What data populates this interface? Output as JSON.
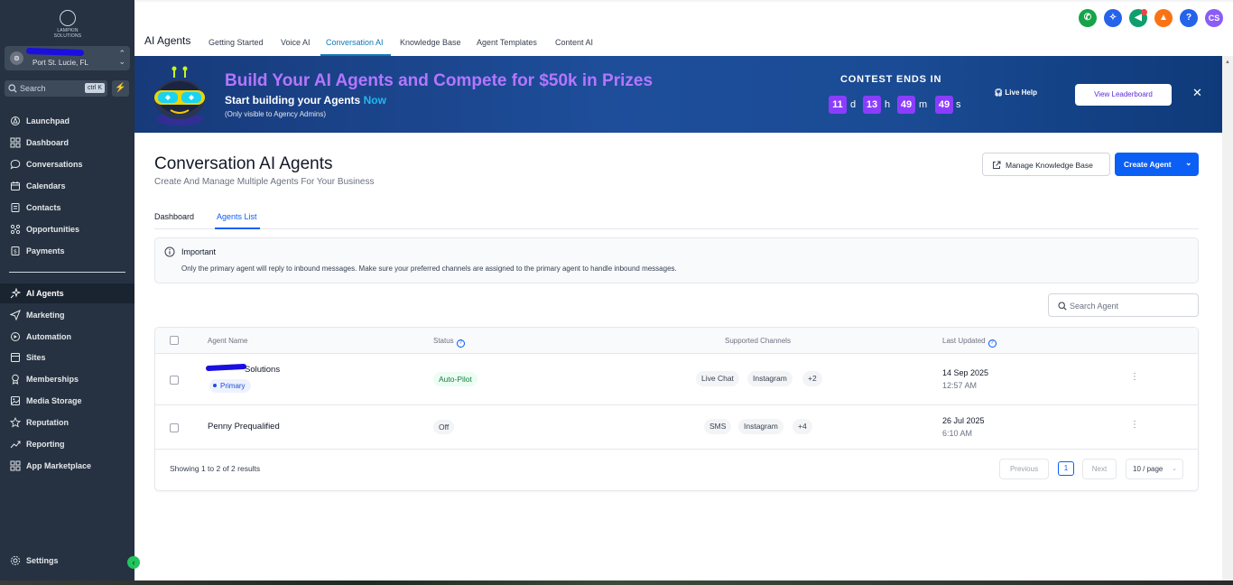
{
  "sidebar": {
    "logo_text": "LAMPKIN SOLUTIONS",
    "location": {
      "avatar": "⊚",
      "city": "Port St. Lucie, FL"
    },
    "search": {
      "placeholder": "Search",
      "shortcut": "ctrl K"
    },
    "nav_top": [
      {
        "label": "Launchpad",
        "icon": "rocket-icon"
      },
      {
        "label": "Dashboard",
        "icon": "grid-icon"
      },
      {
        "label": "Conversations",
        "icon": "chat-icon"
      },
      {
        "label": "Calendars",
        "icon": "calendar-icon"
      },
      {
        "label": "Contacts",
        "icon": "contacts-icon"
      },
      {
        "label": "Opportunities",
        "icon": "opportunities-icon"
      },
      {
        "label": "Payments",
        "icon": "payments-icon"
      }
    ],
    "nav_bottom": [
      {
        "label": "AI Agents",
        "icon": "sparkle-icon",
        "active": true
      },
      {
        "label": "Marketing",
        "icon": "send-icon"
      },
      {
        "label": "Automation",
        "icon": "automation-icon"
      },
      {
        "label": "Sites",
        "icon": "globe-icon"
      },
      {
        "label": "Memberships",
        "icon": "memberships-icon"
      },
      {
        "label": "Media Storage",
        "icon": "image-icon"
      },
      {
        "label": "Reputation",
        "icon": "star-icon"
      },
      {
        "label": "Reporting",
        "icon": "trend-icon"
      },
      {
        "label": "App Marketplace",
        "icon": "apps-icon"
      }
    ],
    "settings_label": "Settings"
  },
  "header": {
    "section_title": "AI Agents",
    "tabs": [
      "Getting Started",
      "Voice AI",
      "Conversation AI",
      "Knowledge Base",
      "Agent Templates",
      "Content AI"
    ],
    "active_tab": "Conversation AI",
    "user_initials": "CS",
    "help_label": "?"
  },
  "banner": {
    "title": "Build Your AI Agents and Compete for $50k in Prizes",
    "subtitle": "Start building your Agents",
    "subtitle_em": "Now",
    "note": "(Only visible to Agency Admins)",
    "contest_label": "CONTEST ENDS IN",
    "countdown": {
      "days": "11",
      "hours": "13",
      "minutes": "49",
      "seconds": "49"
    },
    "units": {
      "d": "d",
      "h": "h",
      "m": "m",
      "s": "s"
    },
    "live_help": "Live Help",
    "leaderboard_button": "View Leaderboard",
    "close": "✕"
  },
  "page": {
    "title": "Conversation AI Agents",
    "subtitle": "Create And Manage Multiple Agents For Your Business",
    "manage_kb_button": "Manage Knowledge Base",
    "create_button": "Create Agent",
    "subtabs": [
      "Dashboard",
      "Agents List"
    ],
    "active_subtab": "Agents List",
    "notice": {
      "title": "Important",
      "text": "Only the primary agent will reply to inbound messages. Make sure your preferred channels are assigned to the primary agent to handle inbound messages."
    },
    "search_placeholder": "Search Agent"
  },
  "table": {
    "columns": [
      "Agent Name",
      "Status",
      "Supported Channels",
      "Last Updated"
    ],
    "rows": [
      {
        "name": "Solutions",
        "badge": "Primary",
        "status": "Auto-Pilot",
        "channels": [
          "Live Chat",
          "Instagram",
          "+2"
        ],
        "date": "14 Sep 2025",
        "time": "12:57 AM"
      },
      {
        "name": "Penny Prequalified",
        "badge": "",
        "status": "Off",
        "channels": [
          "SMS",
          "Instagram",
          "+4"
        ],
        "date": "26 Jul 2025",
        "time": "6:10 AM"
      }
    ],
    "footer": {
      "showing": "Showing 1 to 2 of 2 results",
      "previous": "Previous",
      "page": "1",
      "next": "Next",
      "per_page": "10 / page"
    }
  },
  "colors": {
    "sidebar_bg": "#263241",
    "accent_blue": "#0b5ff5",
    "tab_active": "#0e7ab6",
    "banner_title": "#b476ff",
    "countdown_box": "#8b3dff",
    "status_green": "#15803d"
  }
}
